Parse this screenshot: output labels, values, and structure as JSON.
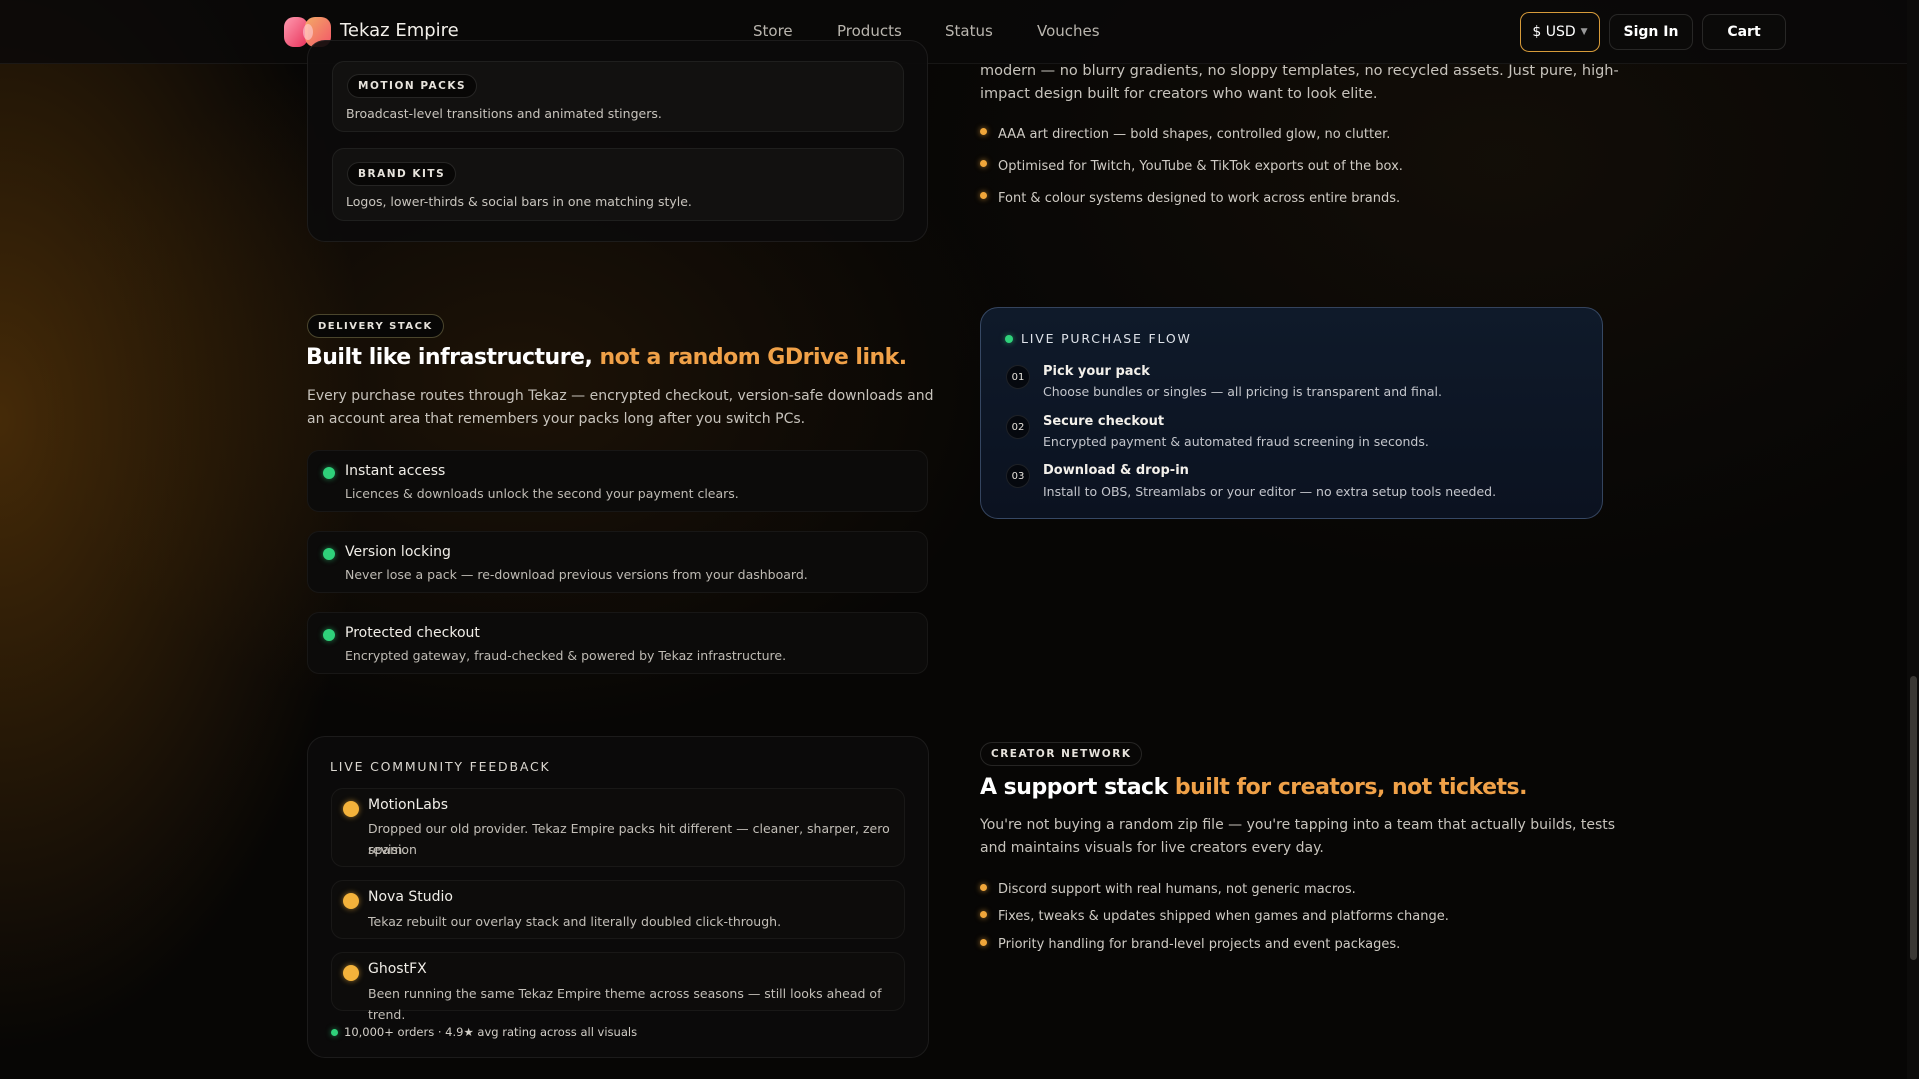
{
  "nav": {
    "brand": "Tekaz Empire",
    "links": [
      "Store",
      "Products",
      "Status",
      "Vouches"
    ],
    "currency": "$ USD",
    "sign_in": "Sign In",
    "cart": "Cart"
  },
  "top_card": {
    "items": [
      {
        "badge": "MOTION PACKS",
        "desc": "Broadcast-level transitions and animated stingers."
      },
      {
        "badge": "BRAND KITS",
        "desc": "Logos, lower-thirds & social bars in one matching style."
      }
    ]
  },
  "intro": {
    "line1": "modern — no blurry gradients, no sloppy templates, no recycled assets. Just pure, high-",
    "line2": "impact design built for creators who want to look elite.",
    "bullets": [
      "AAA art direction — bold shapes, controlled glow, no clutter.",
      "Optimised for Twitch, YouTube & TikTok exports out of the box.",
      "Font & colour systems designed to work across entire brands."
    ]
  },
  "delivery": {
    "badge": "DELIVERY STACK",
    "heading_main": "Built like infrastructure,",
    "heading_accent": "not a random GDrive link.",
    "para_line1": "Every purchase routes through Tekaz — encrypted checkout, version-safe downloads and",
    "para_line2": "an account area that remembers your packs long after you switch PCs.",
    "features": [
      {
        "title": "Instant access",
        "desc": "Licences & downloads unlock the second your payment clears."
      },
      {
        "title": "Version locking",
        "desc": "Never lose a pack — re-download previous versions from your dashboard."
      },
      {
        "title": "Protected checkout",
        "desc": "Encrypted gateway, fraud-checked & powered by Tekaz infrastructure."
      }
    ]
  },
  "purchase_flow": {
    "title": "LIVE PURCHASE FLOW",
    "steps": [
      {
        "num": "01",
        "title": "Pick your pack",
        "desc": "Choose bundles or singles — all pricing is transparent and final."
      },
      {
        "num": "02",
        "title": "Secure checkout",
        "desc": "Encrypted payment & automated fraud screening in seconds."
      },
      {
        "num": "03",
        "title": "Download & drop-in",
        "desc": "Install to OBS, Streamlabs or your editor — no extra setup tools needed."
      }
    ]
  },
  "feedback": {
    "title": "LIVE COMMUNITY FEEDBACK",
    "reviews": [
      {
        "name": "MotionLabs",
        "line1": "Dropped our old provider. Tekaz Empire packs hit different — cleaner, sharper, zero revision",
        "line2": "spam."
      },
      {
        "name": "Nova Studio",
        "line1": "Tekaz rebuilt our overlay stack and literally doubled click-through.",
        "line2": ""
      },
      {
        "name": "GhostFX",
        "line1": "Been running the same Tekaz Empire theme across seasons — still looks ahead of trend.",
        "line2": ""
      }
    ],
    "footer": "10,000+ orders · 4.9★ avg rating across all visuals"
  },
  "creator": {
    "badge": "CREATOR NETWORK",
    "heading_main": "A support stack",
    "heading_accent": "built for creators, not tickets.",
    "para_line1": "You're not buying a random zip file — you're tapping into a team that actually builds, tests",
    "para_line2": "and maintains visuals for live creators every day.",
    "bullets": [
      "Discord support with real humans, not generic macros.",
      "Fixes, tweaks & updates shipped when games and platforms change.",
      "Priority handling for brand-level projects and event packages."
    ]
  },
  "colors": {
    "accent": "#f0a148",
    "green_dot": "#2fd17a",
    "orange_dot": "#f3b23b",
    "currency_border": "#d79b3a"
  },
  "icons": [
    "brand-logo-icon",
    "chevron-down-icon"
  ]
}
